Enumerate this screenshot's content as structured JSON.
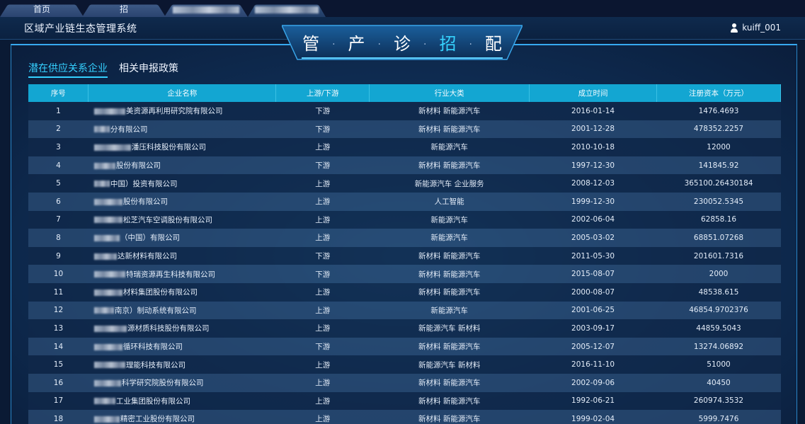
{
  "tabs": [
    {
      "label": "首页"
    },
    {
      "label": "招"
    },
    {
      "label": ""
    },
    {
      "label": ""
    }
  ],
  "header": {
    "title": "区域产业链生态管理系统",
    "user": "kuiff_001"
  },
  "emblem": {
    "chars": [
      "管",
      "产",
      "诊",
      "招",
      "配"
    ],
    "highlight": "招",
    "separator": "·"
  },
  "subtabs": [
    {
      "label": "潜在供应关系企业",
      "active": true
    },
    {
      "label": "相关申报政策",
      "active": false
    }
  ],
  "table": {
    "columns": [
      "序号",
      "企业名称",
      "上游/下游",
      "行业大类",
      "成立时间",
      "注册资本（万元）"
    ],
    "rows": [
      {
        "no": "1",
        "name": "美资源再利用研究院有限公司",
        "up": "下游",
        "ind": "新材料 新能源汽车",
        "date": "2016-01-14",
        "cap": "1476.4693"
      },
      {
        "no": "2",
        "name": "分有限公司",
        "up": "下游",
        "ind": "新材料 新能源汽车",
        "date": "2001-12-28",
        "cap": "478352.2257"
      },
      {
        "no": "3",
        "name": "潘压科技股份有限公司",
        "up": "上游",
        "ind": "新能源汽车",
        "date": "2010-10-18",
        "cap": "12000"
      },
      {
        "no": "4",
        "name": "股份有限公司",
        "up": "下游",
        "ind": "新材料 新能源汽车",
        "date": "1997-12-30",
        "cap": "141845.92"
      },
      {
        "no": "5",
        "name": "中国）投资有限公司",
        "up": "上游",
        "ind": "新能源汽车 企业服务",
        "date": "2008-12-03",
        "cap": "365100.26430184"
      },
      {
        "no": "6",
        "name": "股份有限公司",
        "up": "上游",
        "ind": "人工智能",
        "date": "1999-12-30",
        "cap": "230052.5345"
      },
      {
        "no": "7",
        "name": "松芝汽车空调股份有限公司",
        "up": "上游",
        "ind": "新能源汽车",
        "date": "2002-06-04",
        "cap": "62858.16"
      },
      {
        "no": "8",
        "name": "（中国）有限公司",
        "up": "上游",
        "ind": "新能源汽车",
        "date": "2005-03-02",
        "cap": "68851.07268"
      },
      {
        "no": "9",
        "name": "达新材料有限公司",
        "up": "下游",
        "ind": "新材料 新能源汽车",
        "date": "2011-05-30",
        "cap": "201601.7316"
      },
      {
        "no": "10",
        "name": "特瑞资源再生科技有限公司",
        "up": "下游",
        "ind": "新材料 新能源汽车",
        "date": "2015-08-07",
        "cap": "2000"
      },
      {
        "no": "11",
        "name": "材料集团股份有限公司",
        "up": "上游",
        "ind": "新材料 新能源汽车",
        "date": "2000-08-07",
        "cap": "48538.615"
      },
      {
        "no": "12",
        "name": "南京）制动系统有限公司",
        "up": "上游",
        "ind": "新能源汽车",
        "date": "2001-06-25",
        "cap": "46854.9702376"
      },
      {
        "no": "13",
        "name": "源材质科技股份有限公司",
        "up": "上游",
        "ind": "新能源汽车 新材料",
        "date": "2003-09-17",
        "cap": "44859.5043"
      },
      {
        "no": "14",
        "name": "循环科技有限公司",
        "up": "下游",
        "ind": "新材料 新能源汽车",
        "date": "2005-12-07",
        "cap": "13274.06892"
      },
      {
        "no": "15",
        "name": "理能科技有限公司",
        "up": "上游",
        "ind": "新能源汽车 新材料",
        "date": "2016-11-10",
        "cap": "51000"
      },
      {
        "no": "16",
        "name": "科学研究院股份有限公司",
        "up": "上游",
        "ind": "新材料 新能源汽车",
        "date": "2002-09-06",
        "cap": "40450"
      },
      {
        "no": "17",
        "name": "工业集团股份有限公司",
        "up": "上游",
        "ind": "新材料 新能源汽车",
        "date": "1992-06-21",
        "cap": "260974.3532"
      },
      {
        "no": "18",
        "name": "精密工业股份有限公司",
        "up": "上游",
        "ind": "新材料 新能源汽车",
        "date": "1999-02-04",
        "cap": "5999.7476"
      }
    ]
  }
}
